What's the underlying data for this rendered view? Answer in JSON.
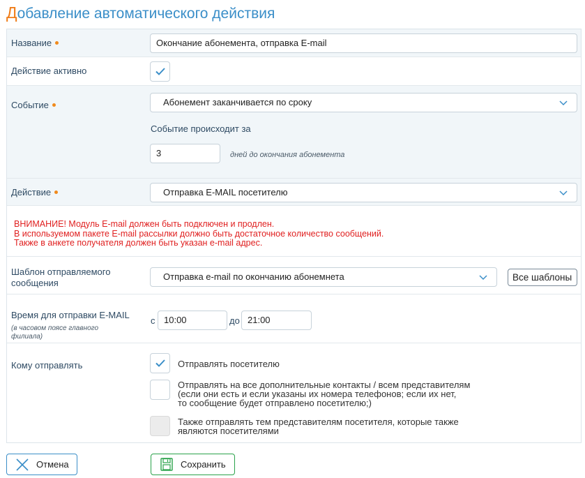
{
  "page": {
    "title_first": "Д",
    "title_rest": "обавление автоматического действия"
  },
  "form": {
    "name": {
      "label": "Название",
      "value": "Окончание абонемента, отправка E-mail"
    },
    "active": {
      "label": "Действие активно",
      "checked": true
    },
    "event": {
      "label": "Событие",
      "selected": "Абонемент заканчивается по сроку",
      "occurs_label": "Событие происходит за",
      "days_value": "3",
      "days_hint": "дней до окончания абонемента"
    },
    "action": {
      "label": "Действие",
      "selected": "Отправка E-MAIL посетителю"
    },
    "warning": {
      "line1": "ВНИМАНИЕ! Модуль E-mail должен быть подключен и продлен.",
      "line2": "В используемом пакете E-mail рассылки должно быть достаточное количество сообщений.",
      "line3": "Также в анкете получателя должен быть указан e-mail адрес."
    },
    "template": {
      "label_line1": "Шаблон отправляемого",
      "label_line2": "сообщения",
      "selected": "Отправка e-mail по окончанию абонемнета",
      "all_templates_label": "Все шаблоны"
    },
    "time": {
      "label": "Время для отправки E-MAIL",
      "note_line1": "(в часовом поясе главного",
      "note_line2": "филиала)",
      "from_label": "с",
      "from_value": "10:00",
      "to_label": "до",
      "to_value": "21:00"
    },
    "recipients": {
      "label": "Кому отправлять",
      "option1": {
        "text": "Отправлять посетителю",
        "checked": true
      },
      "option2": {
        "line1": "Отправлять на все дополнительные контакты / всем представителям",
        "line2": "(если они есть и если указаны их номера телефонов; если их нет,",
        "line3": "то сообщение будет отправлено посетителю;)",
        "checked": false
      },
      "option3": {
        "line1": "Также отправлять тем представителям посетителя, которые также",
        "line2": "являются посетителями",
        "checked": false,
        "disabled": true
      }
    }
  },
  "buttons": {
    "cancel_label": "Отмена",
    "save_label": "Сохранить"
  },
  "colors": {
    "title": "#3a8ec8",
    "title_first_letter": "#f07d1a",
    "warning": "#e02020",
    "required_dot": "#f08a1d",
    "save_border": "#2aa24a"
  }
}
